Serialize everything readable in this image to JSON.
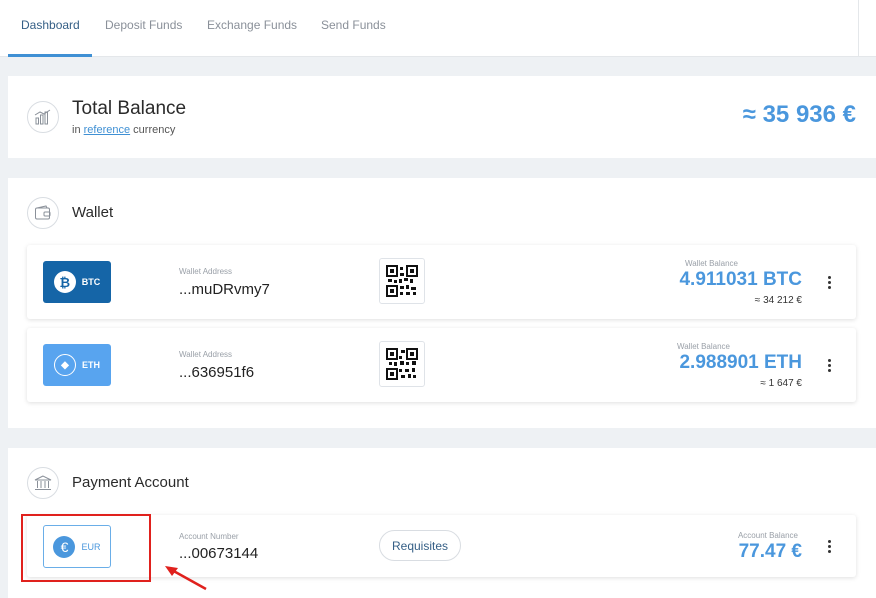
{
  "nav": {
    "tabs": [
      {
        "label": "Dashboard",
        "active": true
      },
      {
        "label": "Deposit Funds",
        "active": false
      },
      {
        "label": "Exchange Funds",
        "active": false
      },
      {
        "label": "Send Funds",
        "active": false
      }
    ]
  },
  "total_balance": {
    "icon": "bar-chart-icon",
    "title": "Total Balance",
    "sub_prefix": "in",
    "sub_link": "reference",
    "sub_suffix": "currency",
    "amount": "≈ 35 936 €"
  },
  "wallet": {
    "icon": "wallet-icon",
    "title": "Wallet",
    "items": [
      {
        "currency": "BTC",
        "coin_symbol": "₿",
        "address_label": "Wallet Address",
        "address": "...muDRvmy7",
        "balance_label": "Wallet Balance",
        "balance": "4.911031 BTC",
        "balance_ref": "≈ 34 212 €"
      },
      {
        "currency": "ETH",
        "coin_symbol": "◆",
        "address_label": "Wallet Address",
        "address": "...636951f6",
        "balance_label": "Wallet Balance",
        "balance": "2.988901 ETH",
        "balance_ref": "≈ 1 647 €"
      }
    ]
  },
  "payment_account": {
    "icon": "bank-icon",
    "title": "Payment Account",
    "items": [
      {
        "currency": "EUR",
        "coin_symbol": "€",
        "number_label": "Account Number",
        "number": "...00673144",
        "requisites_label": "Requisites",
        "balance_label": "Account Balance",
        "balance": "77.47 €"
      }
    ]
  },
  "colors": {
    "accent": "#4a97dd",
    "btc_badge": "#1565a7",
    "eth_badge": "#58a4ef",
    "annotation": "#e0211d"
  }
}
